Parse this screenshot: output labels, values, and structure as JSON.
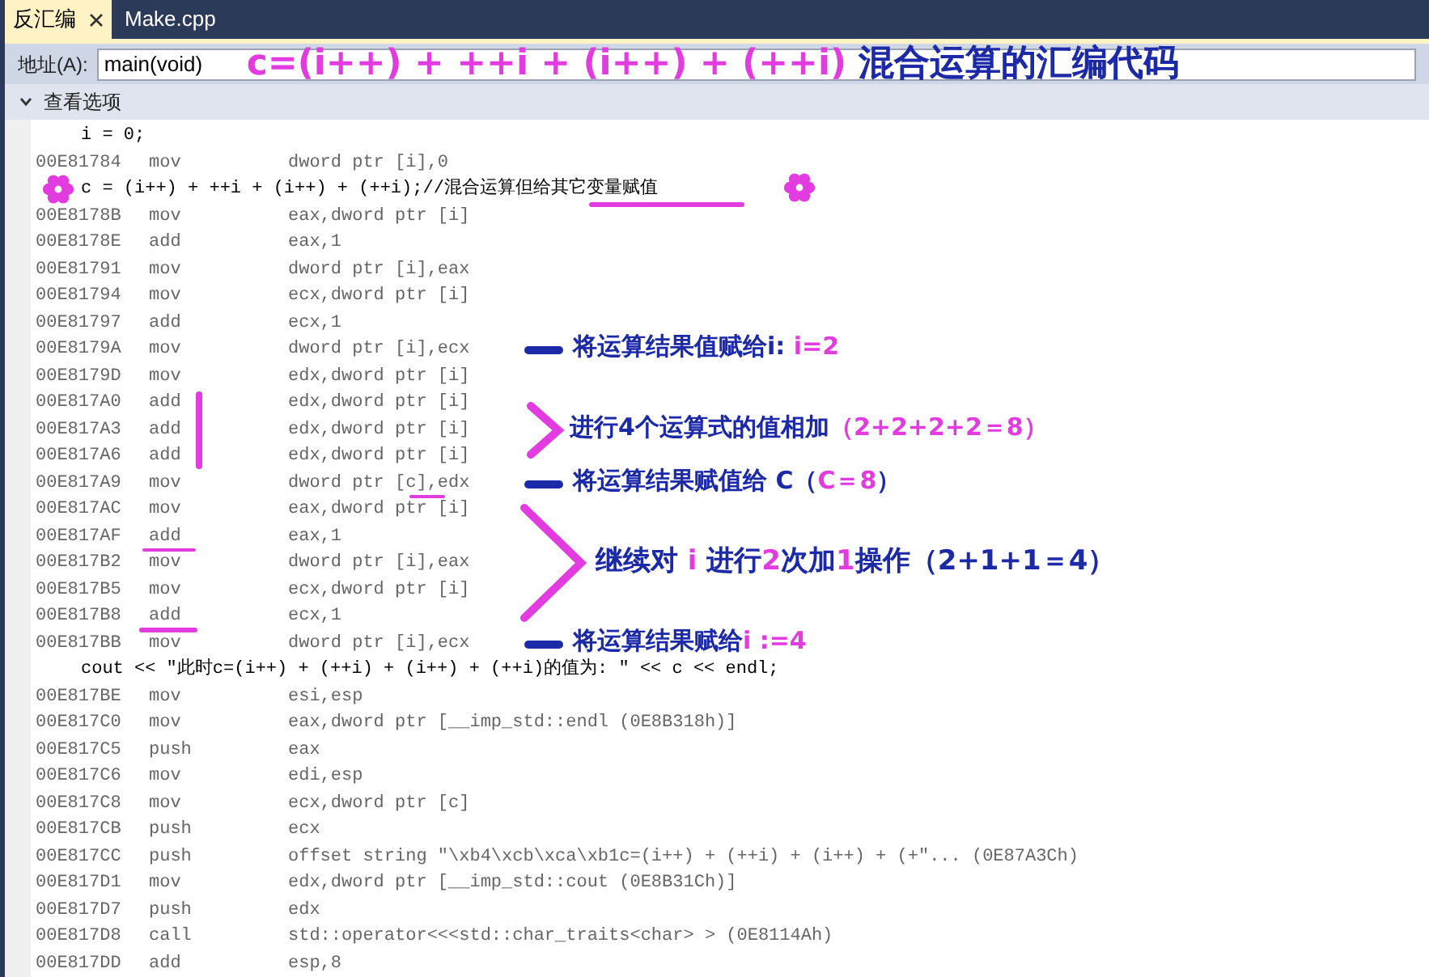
{
  "tabs": [
    {
      "label": "反汇编",
      "selected": true
    },
    {
      "label": "Make.cpp",
      "selected": false
    }
  ],
  "address_bar": {
    "label": "地址(A):",
    "value": "main(void)"
  },
  "view_options": {
    "label": "查看选项",
    "expanded": true
  },
  "headline": [
    {
      "text": "c=(i++) + ++i + (i++) + (++i) ",
      "color": "#e23be0"
    },
    {
      "text": "混合运算的汇编代码",
      "color": "#1c2aa8"
    }
  ],
  "code_lines": [
    {
      "kind": "source",
      "text": "i = 0;"
    },
    {
      "kind": "asm",
      "address": "00E81784",
      "op": "mov",
      "args": "dword ptr [i],0"
    },
    {
      "kind": "source",
      "text": "c = (i++) + ++i + (i++) + (++i);//混合运算但给其它变量赋值"
    },
    {
      "kind": "asm",
      "address": "00E8178B",
      "op": "mov",
      "args": "eax,dword ptr [i]"
    },
    {
      "kind": "asm",
      "address": "00E8178E",
      "op": "add",
      "args": "eax,1"
    },
    {
      "kind": "asm",
      "address": "00E81791",
      "op": "mov",
      "args": "dword ptr [i],eax"
    },
    {
      "kind": "asm",
      "address": "00E81794",
      "op": "mov",
      "args": "ecx,dword ptr [i]"
    },
    {
      "kind": "asm",
      "address": "00E81797",
      "op": "add",
      "args": "ecx,1"
    },
    {
      "kind": "asm",
      "address": "00E8179A",
      "op": "mov",
      "args": "dword ptr [i],ecx"
    },
    {
      "kind": "asm",
      "address": "00E8179D",
      "op": "mov",
      "args": "edx,dword ptr [i]"
    },
    {
      "kind": "asm",
      "address": "00E817A0",
      "op": "add",
      "args": "edx,dword ptr [i]"
    },
    {
      "kind": "asm",
      "address": "00E817A3",
      "op": "add",
      "args": "edx,dword ptr [i]"
    },
    {
      "kind": "asm",
      "address": "00E817A6",
      "op": "add",
      "args": "edx,dword ptr [i]"
    },
    {
      "kind": "asm",
      "address": "00E817A9",
      "op": "mov",
      "args": "dword ptr [c],edx"
    },
    {
      "kind": "asm",
      "address": "00E817AC",
      "op": "mov",
      "args": "eax,dword ptr [i]"
    },
    {
      "kind": "asm",
      "address": "00E817AF",
      "op": "add",
      "args": "eax,1"
    },
    {
      "kind": "asm",
      "address": "00E817B2",
      "op": "mov",
      "args": "dword ptr [i],eax"
    },
    {
      "kind": "asm",
      "address": "00E817B5",
      "op": "mov",
      "args": "ecx,dword ptr [i]"
    },
    {
      "kind": "asm",
      "address": "00E817B8",
      "op": "add",
      "args": "ecx,1"
    },
    {
      "kind": "asm",
      "address": "00E817BB",
      "op": "mov",
      "args": "dword ptr [i],ecx"
    },
    {
      "kind": "source",
      "text": "cout << \"此时c=(i++) + (++i) + (i++) + (++i)的值为: \" << c << endl;"
    },
    {
      "kind": "asm",
      "address": "00E817BE",
      "op": "mov",
      "args": "esi,esp"
    },
    {
      "kind": "asm",
      "address": "00E817C0",
      "op": "mov",
      "args": "eax,dword ptr [__imp_std::endl (0E8B318h)]"
    },
    {
      "kind": "asm",
      "address": "00E817C5",
      "op": "push",
      "args": "eax"
    },
    {
      "kind": "asm",
      "address": "00E817C6",
      "op": "mov",
      "args": "edi,esp"
    },
    {
      "kind": "asm",
      "address": "00E817C8",
      "op": "mov",
      "args": "ecx,dword ptr [c]"
    },
    {
      "kind": "asm",
      "address": "00E817CB",
      "op": "push",
      "args": "ecx"
    },
    {
      "kind": "asm",
      "address": "00E817CC",
      "op": "push",
      "args": "offset string \"\\xb4\\xcb\\xca\\xb1c=(i++) + (++i) + (i++) + (+\"... (0E87A3Ch)"
    },
    {
      "kind": "asm",
      "address": "00E817D1",
      "op": "mov",
      "args": "edx,dword ptr [__imp_std::cout (0E8B31Ch)]"
    },
    {
      "kind": "asm",
      "address": "00E817D7",
      "op": "push",
      "args": "edx"
    },
    {
      "kind": "asm",
      "address": "00E817D8",
      "op": "call",
      "args": "std::operator<<<std::char_traits<char> > (0E8114Ah)"
    },
    {
      "kind": "asm",
      "address": "00E817DD",
      "op": "add",
      "args": "esp,8"
    }
  ],
  "annotations": [
    {
      "kind": "dash",
      "segments": [
        {
          "text": "将运算结果值赋给i: ",
          "color": "#1c2aa8"
        },
        {
          "text": "i=2",
          "color": "#e23be0"
        }
      ]
    },
    {
      "kind": "bracket",
      "segments": [
        {
          "text": "进行4个运算式的值相加",
          "color": "#1c2aa8"
        },
        {
          "text": "（2+2+2+2＝8）",
          "color": "#e23be0"
        }
      ]
    },
    {
      "kind": "dash",
      "segments": [
        {
          "text": "将运算结果赋值给 C（",
          "color": "#1c2aa8"
        },
        {
          "text": "C＝8",
          "color": "#e23be0"
        },
        {
          "text": "）",
          "color": "#1c2aa8"
        }
      ]
    },
    {
      "kind": "big-bracket",
      "segments": [
        {
          "text": "继续对 ",
          "color": "#1c2aa8"
        },
        {
          "text": "i",
          "color": "#e23be0"
        },
        {
          "text": " 进行",
          "color": "#1c2aa8"
        },
        {
          "text": "2",
          "color": "#e23be0"
        },
        {
          "text": "次加",
          "color": "#1c2aa8"
        },
        {
          "text": "1",
          "color": "#e23be0"
        },
        {
          "text": "操作（2+1+1＝4）",
          "color": "#1c2aa8"
        }
      ]
    },
    {
      "kind": "dash",
      "segments": [
        {
          "text": "将运算结果赋给",
          "color": "#1c2aa8"
        },
        {
          "text": "i :=4",
          "color": "#e23be0"
        }
      ]
    }
  ]
}
